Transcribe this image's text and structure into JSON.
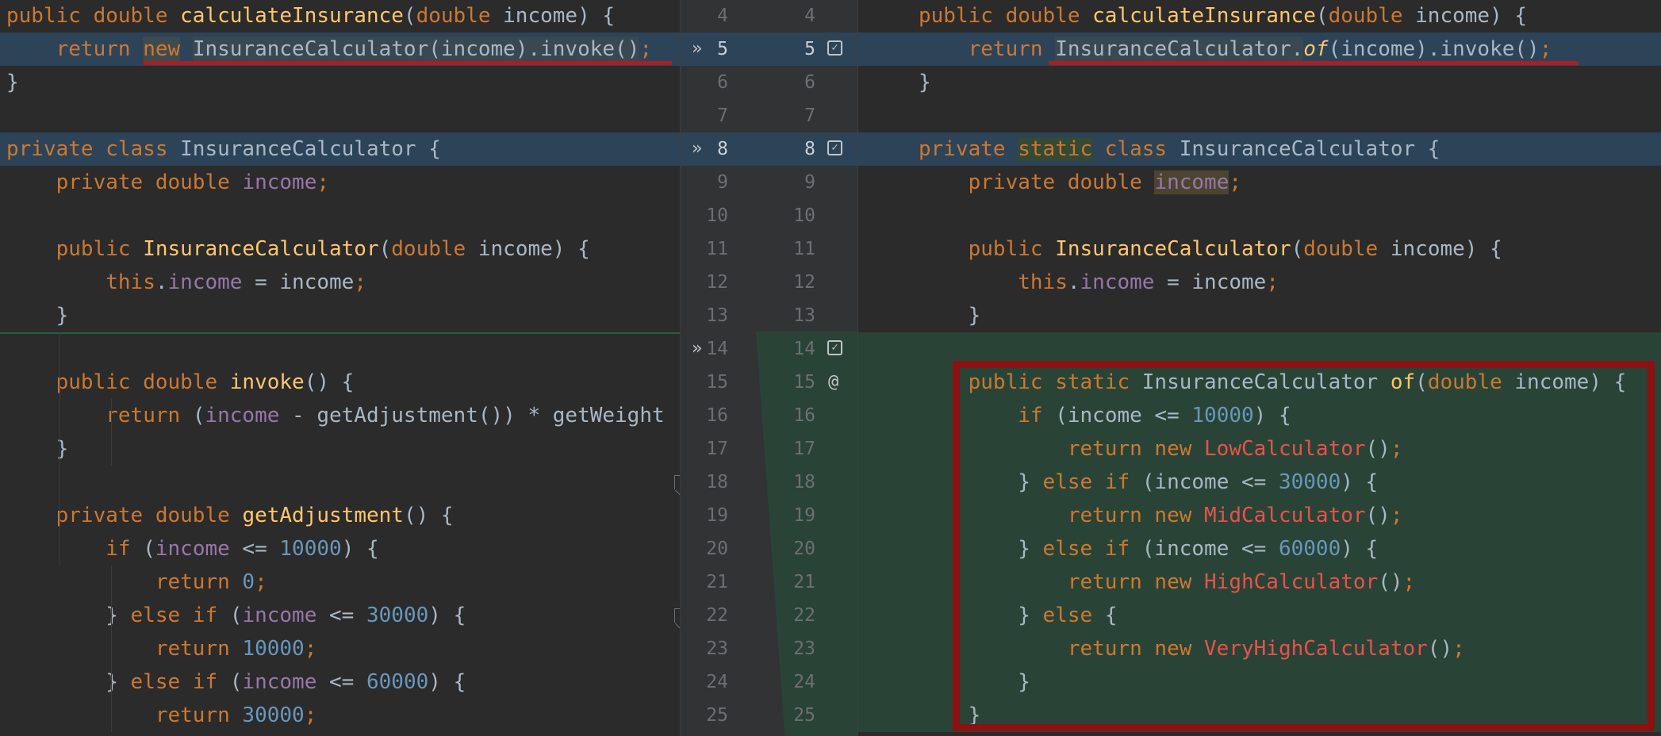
{
  "left_lines": [
    {
      "tokens": [
        [
          "k",
          "public double "
        ],
        [
          "f",
          "calculateInsurance"
        ],
        [
          "p",
          "("
        ],
        [
          "k",
          "double "
        ],
        [
          "p",
          "income) {"
        ]
      ]
    },
    {
      "tokens": [
        [
          "p",
          "    "
        ],
        [
          "k",
          "return "
        ],
        [
          "k hlword-new",
          "new"
        ],
        [
          "p",
          " "
        ],
        [
          "p hlbox-old",
          "InsuranceCalculator(income).invoke()"
        ],
        [
          "k",
          ";"
        ]
      ]
    },
    {
      "tokens": [
        [
          "p",
          "}"
        ]
      ]
    },
    {
      "tokens": []
    },
    {
      "tokens": [
        [
          "k",
          "private class "
        ],
        [
          "p",
          "InsuranceCalculator {"
        ]
      ]
    },
    {
      "tokens": [
        [
          "p",
          "    "
        ],
        [
          "k",
          "private double "
        ],
        [
          "v",
          "income"
        ],
        [
          "k",
          ";"
        ]
      ]
    },
    {
      "tokens": []
    },
    {
      "tokens": [
        [
          "p",
          "    "
        ],
        [
          "k",
          "public "
        ],
        [
          "f",
          "InsuranceCalculator"
        ],
        [
          "p",
          "("
        ],
        [
          "k",
          "double "
        ],
        [
          "p",
          "income) {"
        ]
      ]
    },
    {
      "tokens": [
        [
          "p",
          "        "
        ],
        [
          "k",
          "this"
        ],
        [
          "p",
          "."
        ],
        [
          "v",
          "income"
        ],
        [
          "p",
          " = income"
        ],
        [
          "k",
          ";"
        ]
      ]
    },
    {
      "tokens": [
        [
          "p",
          "    }"
        ]
      ]
    },
    {
      "tokens": []
    },
    {
      "tokens": [
        [
          "p",
          "    "
        ],
        [
          "k",
          "public double "
        ],
        [
          "f",
          "invoke"
        ],
        [
          "p",
          "() {"
        ]
      ]
    },
    {
      "tokens": [
        [
          "p",
          "        "
        ],
        [
          "k",
          "return "
        ],
        [
          "p",
          "("
        ],
        [
          "v",
          "income"
        ],
        [
          "p",
          " - getAdjustment()) * getWeight"
        ]
      ]
    },
    {
      "tokens": [
        [
          "p",
          "    }"
        ]
      ]
    },
    {
      "tokens": []
    },
    {
      "tokens": [
        [
          "p",
          "    "
        ],
        [
          "k",
          "private double "
        ],
        [
          "f",
          "getAdjustment"
        ],
        [
          "p",
          "() {"
        ]
      ]
    },
    {
      "tokens": [
        [
          "p",
          "        "
        ],
        [
          "k",
          "if "
        ],
        [
          "p",
          "("
        ],
        [
          "v",
          "income"
        ],
        [
          "p",
          " <= "
        ],
        [
          "n",
          "10000"
        ],
        [
          "p",
          ") {"
        ]
      ]
    },
    {
      "tokens": [
        [
          "p",
          "            "
        ],
        [
          "k",
          "return "
        ],
        [
          "n",
          "0"
        ],
        [
          "k",
          ";"
        ]
      ]
    },
    {
      "tokens": [
        [
          "p",
          "        } "
        ],
        [
          "k",
          "else if "
        ],
        [
          "p",
          "("
        ],
        [
          "v",
          "income"
        ],
        [
          "p",
          " <= "
        ],
        [
          "n",
          "30000"
        ],
        [
          "p",
          ") {"
        ]
      ]
    },
    {
      "tokens": [
        [
          "p",
          "            "
        ],
        [
          "k",
          "return "
        ],
        [
          "n",
          "10000"
        ],
        [
          "k",
          ";"
        ]
      ]
    },
    {
      "tokens": [
        [
          "p",
          "        } "
        ],
        [
          "k",
          "else if "
        ],
        [
          "p",
          "("
        ],
        [
          "v",
          "income"
        ],
        [
          "p",
          " <= "
        ],
        [
          "n",
          "60000"
        ],
        [
          "p",
          ") {"
        ]
      ]
    },
    {
      "tokens": [
        [
          "p",
          "            "
        ],
        [
          "k",
          "return "
        ],
        [
          "n",
          "30000"
        ],
        [
          "k",
          ";"
        ]
      ]
    }
  ],
  "right_lines": [
    {
      "tokens": [
        [
          "k",
          "public double "
        ],
        [
          "f",
          "calculateInsurance"
        ],
        [
          "p",
          "("
        ],
        [
          "k",
          "double "
        ],
        [
          "p",
          "income) {"
        ]
      ]
    },
    {
      "tokens": [
        [
          "p",
          "    "
        ],
        [
          "k",
          "return "
        ],
        [
          "p hlbox-old",
          "InsuranceCalculator."
        ],
        [
          "f i",
          "of"
        ],
        [
          "p",
          "(income).invoke()"
        ],
        [
          "k",
          ";"
        ]
      ]
    },
    {
      "tokens": [
        [
          "p",
          "}"
        ]
      ]
    },
    {
      "tokens": []
    },
    {
      "tokens": [
        [
          "k",
          "private "
        ],
        [
          "k hlword-static",
          "static"
        ],
        [
          "k",
          " class "
        ],
        [
          "p",
          "InsuranceCalculator {"
        ]
      ]
    },
    {
      "tokens": [
        [
          "p",
          "    "
        ],
        [
          "k",
          "private double "
        ],
        [
          "v hlword-income",
          "income"
        ],
        [
          "k",
          ";"
        ]
      ]
    },
    {
      "tokens": []
    },
    {
      "tokens": [
        [
          "p",
          "    "
        ],
        [
          "k",
          "public "
        ],
        [
          "f",
          "InsuranceCalculator"
        ],
        [
          "p",
          "("
        ],
        [
          "k",
          "double "
        ],
        [
          "p",
          "income) {"
        ]
      ]
    },
    {
      "tokens": [
        [
          "p",
          "        "
        ],
        [
          "k",
          "this"
        ],
        [
          "p",
          "."
        ],
        [
          "v",
          "income"
        ],
        [
          "p",
          " = income"
        ],
        [
          "k",
          ";"
        ]
      ]
    },
    {
      "tokens": [
        [
          "p",
          "    }"
        ]
      ]
    },
    {
      "tokens": []
    },
    {
      "tokens": [
        [
          "p",
          "    "
        ],
        [
          "k",
          "public static "
        ],
        [
          "p",
          "InsuranceCalculator "
        ],
        [
          "f",
          "of"
        ],
        [
          "p",
          "("
        ],
        [
          "k",
          "double "
        ],
        [
          "p",
          "income) {"
        ]
      ]
    },
    {
      "tokens": [
        [
          "p",
          "        "
        ],
        [
          "k",
          "if "
        ],
        [
          "p",
          "(income <= "
        ],
        [
          "n",
          "10000"
        ],
        [
          "p",
          ") {"
        ]
      ]
    },
    {
      "tokens": [
        [
          "p",
          "            "
        ],
        [
          "k",
          "return new "
        ],
        [
          "r",
          "LowCalculator"
        ],
        [
          "p",
          "()"
        ],
        [
          "k",
          ";"
        ]
      ]
    },
    {
      "tokens": [
        [
          "p",
          "        } "
        ],
        [
          "k",
          "else if "
        ],
        [
          "p",
          "(income <= "
        ],
        [
          "n",
          "30000"
        ],
        [
          "p",
          ") {"
        ]
      ]
    },
    {
      "tokens": [
        [
          "p",
          "            "
        ],
        [
          "k",
          "return new "
        ],
        [
          "r",
          "MidCalculator"
        ],
        [
          "p",
          "()"
        ],
        [
          "k",
          ";"
        ]
      ]
    },
    {
      "tokens": [
        [
          "p",
          "        } "
        ],
        [
          "k",
          "else if "
        ],
        [
          "p",
          "(income <= "
        ],
        [
          "n",
          "60000"
        ],
        [
          "p",
          ") {"
        ]
      ]
    },
    {
      "tokens": [
        [
          "p",
          "            "
        ],
        [
          "k",
          "return new "
        ],
        [
          "r",
          "HighCalculator"
        ],
        [
          "p",
          "()"
        ],
        [
          "k",
          ";"
        ]
      ]
    },
    {
      "tokens": [
        [
          "p",
          "        } "
        ],
        [
          "k",
          "else "
        ],
        [
          "p",
          "{"
        ]
      ]
    },
    {
      "tokens": [
        [
          "p",
          "            "
        ],
        [
          "k",
          "return new "
        ],
        [
          "r",
          "VeryHighCalculator"
        ],
        [
          "p",
          "()"
        ],
        [
          "k",
          ";"
        ]
      ]
    },
    {
      "tokens": [
        [
          "p",
          "        }"
        ]
      ]
    },
    {
      "tokens": [
        [
          "p",
          "    }"
        ]
      ]
    }
  ],
  "gutter": {
    "left_numbers": [
      "4",
      "5",
      "6",
      "7",
      "8",
      "9",
      "10",
      "11",
      "12",
      "13",
      "14",
      "15",
      "16",
      "17",
      "18",
      "19",
      "20",
      "21",
      "22",
      "23",
      "24",
      "25"
    ],
    "right_numbers": [
      "4",
      "5",
      "6",
      "7",
      "8",
      "9",
      "10",
      "11",
      "12",
      "13",
      "14",
      "15",
      "16",
      "17",
      "18",
      "19",
      "20",
      "21",
      "22",
      "23",
      "24",
      "25"
    ],
    "accept_icon": "double-chevron-right-icon",
    "check_icon": "checkbox-checked-icon",
    "at_marker": "@"
  },
  "colors": {
    "background": "#2b2b2b",
    "keyword": "#cc7832",
    "function": "#ffc66d",
    "field": "#9876aa",
    "number": "#6897bb",
    "new_class": "#e8524a",
    "changed_line": "#2d4358",
    "inserted_block": "#294436",
    "annotation_red": "#8c1212"
  }
}
